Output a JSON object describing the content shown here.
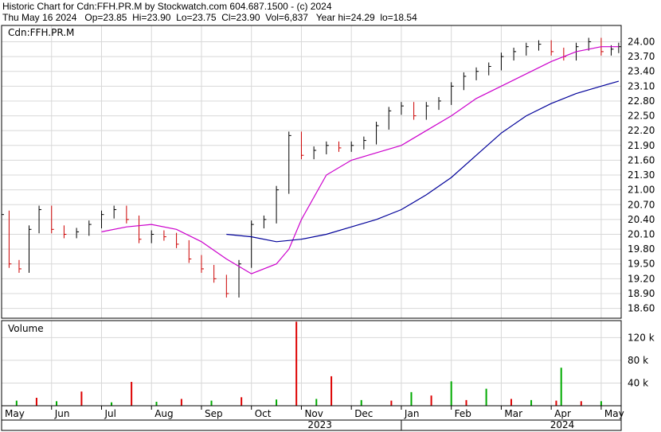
{
  "header": {
    "line1": "Historic Chart for Cdn:FFH.PR.M by Stockwatch.com 604.687.1500 - (c) 2024",
    "line2": "Thu May 16 2024   Op=23.85  Hi=23.90  Lo=23.75  Cl=23.90  Vol=6,837   Year hi=24.29  lo=18.54"
  },
  "colors": {
    "bar_up": "#000000",
    "bar_down": "#cc0000",
    "ma_short": "#cc00cc",
    "ma_long": "#000099",
    "vol_up": "#00aa00",
    "vol_down": "#dd0000",
    "grid": "#d8d8d8",
    "frame": "#000000"
  },
  "chart_data": [
    {
      "type": "line",
      "chart_title": "Cdn:FFH.PR.M",
      "yticks": [
        24.0,
        23.7,
        23.4,
        23.1,
        22.8,
        22.5,
        22.2,
        21.9,
        21.6,
        21.3,
        21.0,
        20.7,
        20.4,
        20.1,
        19.8,
        19.5,
        19.2,
        18.9,
        18.6
      ],
      "ylim": [
        18.4,
        24.33
      ],
      "xlim": [
        0,
        12.4
      ],
      "grid": true,
      "series": [
        {
          "name": "",
          "kind": "price",
          "x": [
            0.0,
            0.15,
            0.35,
            0.55,
            0.75,
            1.0,
            1.25,
            1.5,
            1.75,
            2.0,
            2.25,
            2.5,
            2.75,
            3.0,
            3.25,
            3.5,
            3.75,
            4.0,
            4.25,
            4.5,
            4.75,
            5.0,
            5.25,
            5.5,
            5.75,
            6.0,
            6.25,
            6.5,
            6.75,
            7.0,
            7.25,
            7.5,
            7.75,
            8.0,
            8.25,
            8.5,
            8.75,
            9.0,
            9.25,
            9.5,
            9.75,
            10.0,
            10.25,
            10.5,
            10.75,
            11.0,
            11.25,
            11.5,
            11.75,
            12.0,
            12.2,
            12.35
          ],
          "y": [
            20.5,
            19.5,
            19.4,
            20.2,
            20.6,
            20.2,
            20.1,
            20.15,
            20.3,
            20.5,
            20.6,
            20.4,
            20.0,
            20.1,
            20.05,
            19.9,
            19.6,
            19.4,
            19.2,
            18.9,
            19.5,
            20.3,
            20.4,
            21.0,
            22.1,
            21.7,
            21.8,
            21.9,
            21.85,
            21.9,
            22.0,
            22.3,
            22.6,
            22.7,
            22.5,
            22.7,
            22.8,
            23.1,
            23.3,
            23.4,
            23.5,
            23.7,
            23.8,
            23.9,
            23.95,
            23.8,
            23.7,
            23.9,
            24.0,
            23.8,
            23.85,
            23.9
          ]
        },
        {
          "name": "",
          "kind": "ma_short",
          "x": [
            2.0,
            2.5,
            3.0,
            3.5,
            4.0,
            4.5,
            5.0,
            5.5,
            5.75,
            6.0,
            6.5,
            7.0,
            7.5,
            8.0,
            8.5,
            9.0,
            9.5,
            10.0,
            10.5,
            11.0,
            11.5,
            12.0,
            12.35
          ],
          "y": [
            20.15,
            20.25,
            20.3,
            20.2,
            19.95,
            19.6,
            19.3,
            19.5,
            19.8,
            20.4,
            21.3,
            21.6,
            21.75,
            21.9,
            22.2,
            22.5,
            22.85,
            23.1,
            23.35,
            23.6,
            23.8,
            23.9,
            23.9
          ]
        },
        {
          "name": "",
          "kind": "ma_long",
          "x": [
            4.5,
            5.0,
            5.5,
            6.0,
            6.5,
            7.0,
            7.5,
            8.0,
            8.5,
            9.0,
            9.5,
            10.0,
            10.5,
            11.0,
            11.5,
            12.0,
            12.35
          ],
          "y": [
            20.1,
            20.05,
            19.95,
            20.0,
            20.1,
            20.25,
            20.4,
            20.6,
            20.9,
            21.25,
            21.7,
            22.15,
            22.5,
            22.75,
            22.95,
            23.1,
            23.2
          ]
        }
      ]
    },
    {
      "type": "bar",
      "chart_title": "Volume",
      "yticks": [
        40000,
        80000,
        120000
      ],
      "ytick_labels": [
        "40 k",
        "80 k",
        "120 k"
      ],
      "ylim": [
        0,
        150000
      ],
      "months": [
        "May",
        "Jun",
        "Jul",
        "Aug",
        "Sep",
        "Oct",
        "Nov",
        "Dec",
        "Jan",
        "Feb",
        "Mar",
        "Apr",
        "May"
      ],
      "years": [
        "2023",
        "2024"
      ],
      "series": [
        {
          "name": "",
          "x": [
            0.3,
            0.7,
            1.1,
            1.6,
            2.2,
            2.6,
            3.1,
            3.6,
            4.2,
            4.8,
            5.5,
            5.9,
            6.3,
            6.6,
            7.2,
            7.8,
            8.2,
            8.6,
            9.0,
            9.3,
            9.7,
            10.2,
            10.6,
            11.1,
            11.2,
            11.6,
            12.0
          ],
          "values": [
            9000,
            14000,
            8000,
            25000,
            6000,
            42000,
            7000,
            12000,
            9000,
            15000,
            11000,
            148000,
            12000,
            52000,
            10000,
            9000,
            24000,
            18000,
            43000,
            10000,
            30000,
            12000,
            10000,
            9000,
            67000,
            8000,
            8000
          ]
        }
      ]
    }
  ]
}
